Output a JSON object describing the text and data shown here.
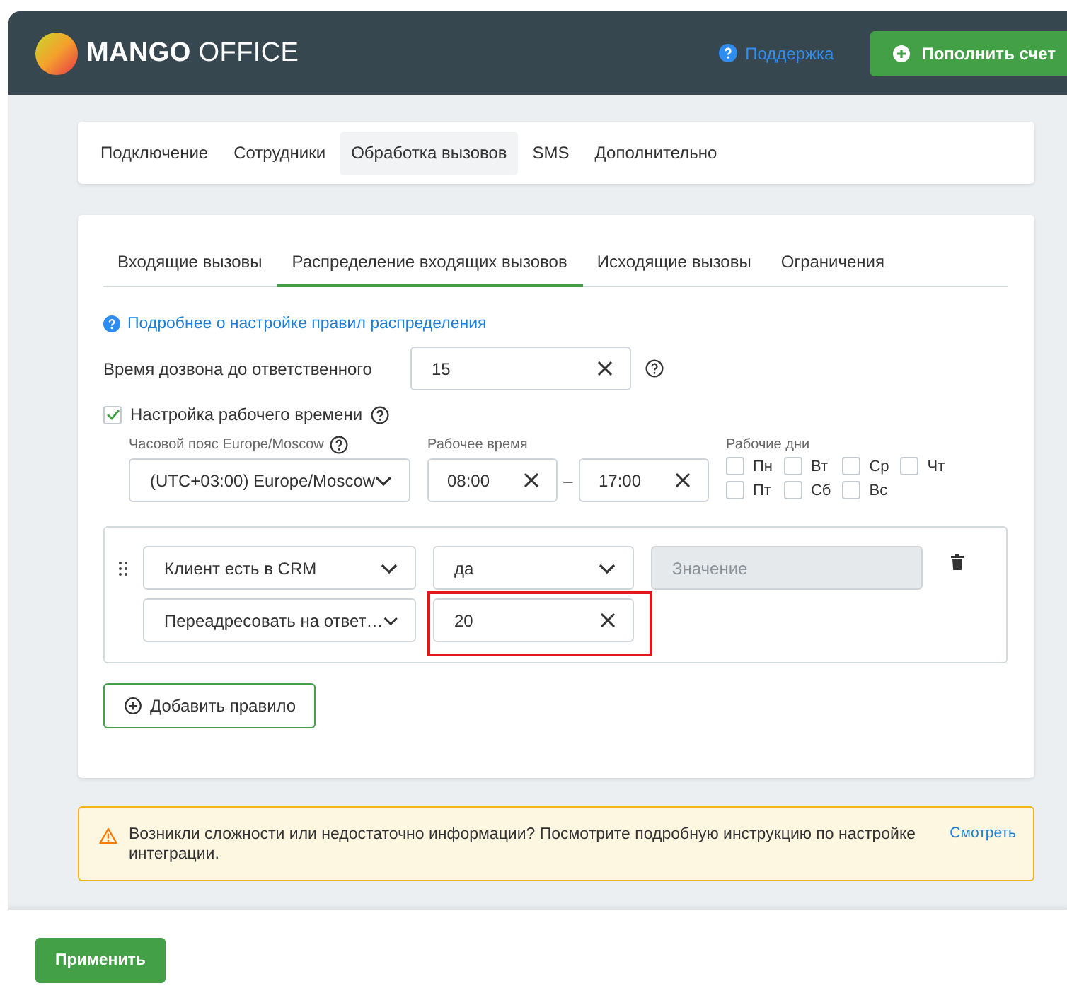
{
  "header": {
    "logo": {
      "brand": "MANGO",
      "suffix": "OFFICE"
    },
    "support_link": "Поддержка",
    "topup_button": "Пополнить счет"
  },
  "nav_tabs": [
    {
      "label": "Подключение",
      "selected": false
    },
    {
      "label": "Сотрудники",
      "selected": false
    },
    {
      "label": "Обработка вызовов",
      "selected": true
    },
    {
      "label": "SMS",
      "selected": false
    },
    {
      "label": "Дополнительно",
      "selected": false
    }
  ],
  "sub_tabs": [
    {
      "label": "Входящие вызовы",
      "selected": false
    },
    {
      "label": "Распределение входящих вызовов",
      "selected": true
    },
    {
      "label": "Исходящие вызовы",
      "selected": false
    },
    {
      "label": "Ограничения",
      "selected": false
    }
  ],
  "info_link": "Подробнее о настройке правил распределения",
  "ring_time": {
    "label": "Время дозвона до ответственного",
    "value": "15"
  },
  "work_time": {
    "label": "Настройка рабочего времени",
    "checked": true,
    "timezone": {
      "label": "Часовой пояс Europe/Moscow",
      "value": "(UTC+03:00) Europe/Moscow"
    },
    "hours": {
      "label": "Рабочее время",
      "from": "08:00",
      "separator": "–",
      "to": "17:00"
    },
    "days_label": "Рабочие дни",
    "days": [
      {
        "label": "Пн",
        "checked": false
      },
      {
        "label": "Вт",
        "checked": false
      },
      {
        "label": "Ср",
        "checked": false
      },
      {
        "label": "Чт",
        "checked": false
      },
      {
        "label": "Пт",
        "checked": false
      },
      {
        "label": "Сб",
        "checked": false
      },
      {
        "label": "Вс",
        "checked": false
      }
    ]
  },
  "rule": {
    "condition": "Клиент есть в CRM",
    "operator": "да",
    "value_placeholder": "Значение",
    "value_disabled": true,
    "action": "Переадресовать на ответ…",
    "action_value": "20",
    "action_value_highlighted": true
  },
  "add_rule_button": "Добавить правило",
  "alert": {
    "text": "Возникли сложности или недостаточно информации? Посмотрите подробную инструкцию по настройке интеграции.",
    "link": "Смотреть"
  },
  "apply_button": "Применить"
}
